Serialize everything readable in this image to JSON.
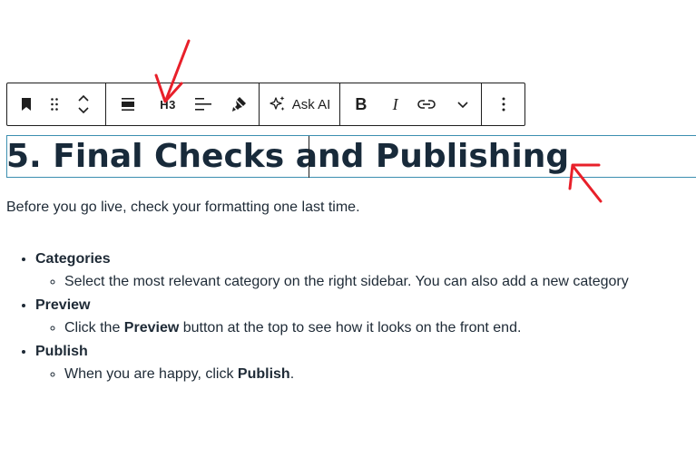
{
  "toolbar": {
    "heading_level": "H3",
    "ask_ai_label": "Ask AI",
    "bold_label": "B",
    "italic_label": "I"
  },
  "heading": "5. Final Checks and Publishing",
  "intro": "Before you go live, check your formatting one last time.",
  "list": [
    {
      "title": "Categories",
      "sub": "Select the most relevant category on the right sidebar. You can also add a new category"
    },
    {
      "title": "Preview",
      "sub_before": "Click the ",
      "sub_bold": "Preview",
      "sub_after": " button at the top to see how it looks on the front end."
    },
    {
      "title": "Publish",
      "sub_before": "When you are happy, click ",
      "sub_bold": "Publish",
      "sub_after": "."
    }
  ],
  "icons": [
    "bookmark-icon",
    "drag-handle-icon",
    "chevron-up-icon",
    "chevron-down-icon",
    "align-icon",
    "text-align-icon",
    "highlighter-icon",
    "sparkles-icon",
    "link-icon",
    "more-vertical-icon"
  ],
  "colors": {
    "text": "#1e1e1e",
    "heading": "#182a3a",
    "block_outline": "#3c8fb0",
    "annotation": "#e8202a"
  }
}
